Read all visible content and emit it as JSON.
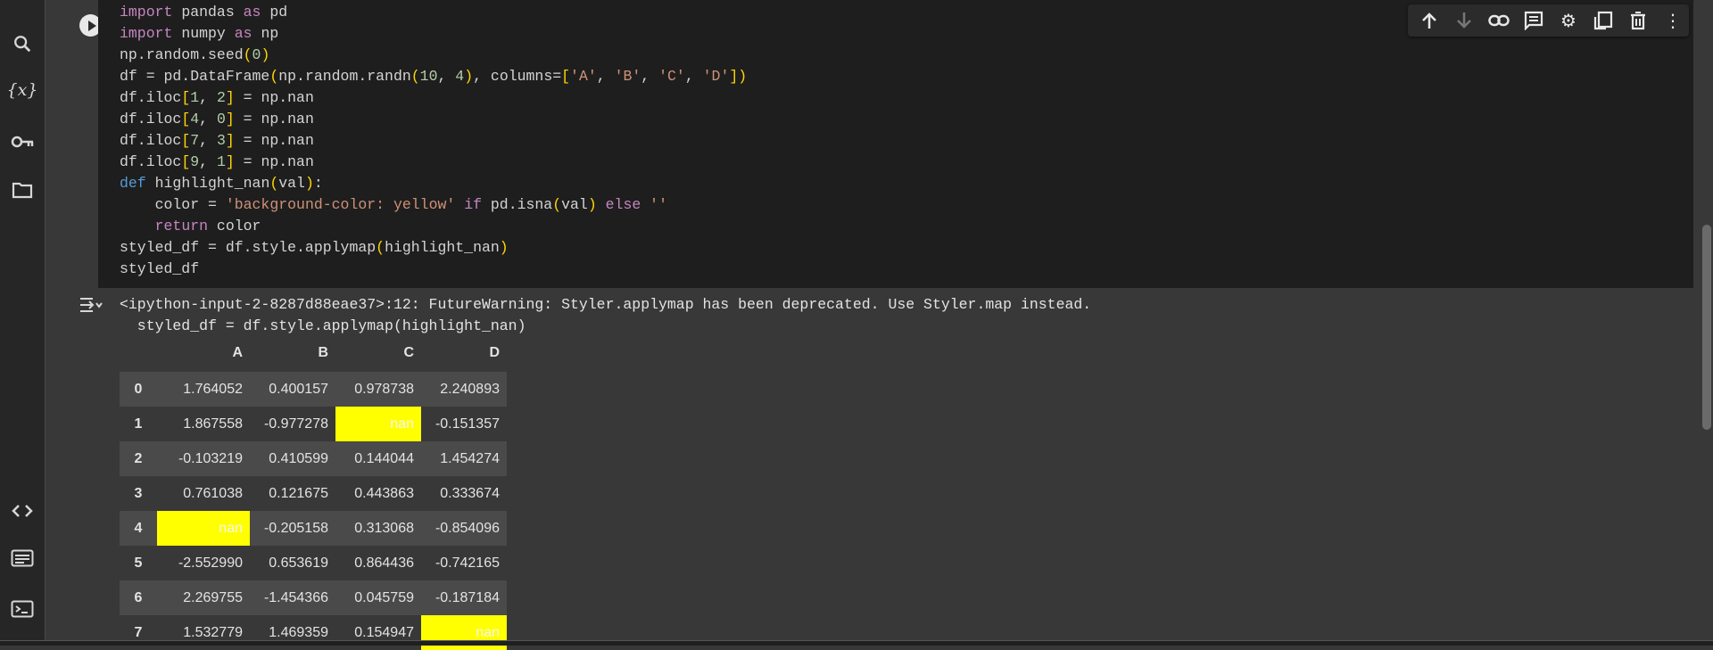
{
  "sidebar": {
    "items": [
      {
        "name": "search-icon",
        "glyph": "🔍"
      },
      {
        "name": "variables-icon",
        "glyph": "{x}"
      },
      {
        "name": "key-icon",
        "glyph": "⚿"
      },
      {
        "name": "folder-icon",
        "glyph": "🗀"
      }
    ],
    "bottom_items": [
      {
        "name": "code-snippets-icon",
        "glyph": "<>"
      },
      {
        "name": "command-palette-icon",
        "glyph": "☰"
      },
      {
        "name": "terminal-icon",
        "glyph": ">_"
      }
    ]
  },
  "cell_toolbar": [
    {
      "name": "move-up-icon",
      "glyph": "↑"
    },
    {
      "name": "move-down-icon",
      "glyph": "↓"
    },
    {
      "name": "link-icon",
      "glyph": "🔗"
    },
    {
      "name": "comment-icon",
      "glyph": "🗨"
    },
    {
      "name": "settings-icon",
      "glyph": "⚙"
    },
    {
      "name": "mirror-cell-icon",
      "glyph": "⧉"
    },
    {
      "name": "delete-icon",
      "glyph": "🗑"
    },
    {
      "name": "more-icon",
      "glyph": "⋮"
    }
  ],
  "output": {
    "warning_line1": "<ipython-input-2-8287d88eae37>:12: FutureWarning: Styler.applymap has been deprecated. Use Styler.map instead.",
    "warning_line2": "  styled_df = df.style.applymap(highlight_nan)"
  },
  "dataframe": {
    "columns": [
      "A",
      "B",
      "C",
      "D"
    ],
    "rows": [
      {
        "index": "0",
        "values": [
          "1.764052",
          "0.400157",
          "0.978738",
          "2.240893"
        ]
      },
      {
        "index": "1",
        "values": [
          "1.867558",
          "-0.977278",
          "nan",
          "-0.151357"
        ]
      },
      {
        "index": "2",
        "values": [
          "-0.103219",
          "0.410599",
          "0.144044",
          "1.454274"
        ]
      },
      {
        "index": "3",
        "values": [
          "0.761038",
          "0.121675",
          "0.443863",
          "0.333674"
        ]
      },
      {
        "index": "4",
        "values": [
          "nan",
          "-0.205158",
          "0.313068",
          "-0.854096"
        ]
      },
      {
        "index": "5",
        "values": [
          "-2.552990",
          "0.653619",
          "0.864436",
          "-0.742165"
        ]
      },
      {
        "index": "6",
        "values": [
          "2.269755",
          "-1.454366",
          "0.045759",
          "-0.187184"
        ]
      },
      {
        "index": "7",
        "values": [
          "1.532779",
          "1.469359",
          "0.154947",
          "nan"
        ]
      }
    ],
    "highlight_color": "#ffff00"
  },
  "colors": {
    "code_background": "#1e1e1e",
    "page_background": "#383838",
    "keyword": "#c586c0",
    "string": "#ce9178",
    "number": "#b5cea8"
  }
}
